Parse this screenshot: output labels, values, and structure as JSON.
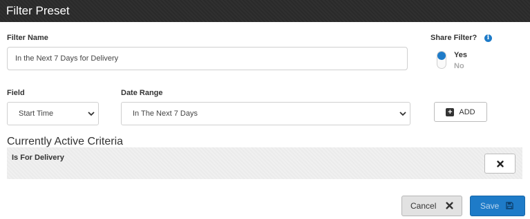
{
  "dialog": {
    "title": "Filter Preset"
  },
  "filter_name": {
    "label": "Filter Name",
    "value": "In the Next 7 Days for Delivery"
  },
  "share": {
    "label": "Share Filter?",
    "info_icon": "info-icon",
    "yes": "Yes",
    "no": "No",
    "selected": "Yes"
  },
  "field": {
    "label": "Field",
    "value": "Start Time"
  },
  "date_range": {
    "label": "Date Range",
    "value": "In The Next 7 Days"
  },
  "add_button": {
    "label": "ADD",
    "icon": "plus-square-icon"
  },
  "criteria": {
    "title": "Currently Active Criteria",
    "items": [
      {
        "label": "Is For Delivery"
      }
    ]
  },
  "footer": {
    "cancel_label": "Cancel",
    "save_label": "Save"
  },
  "colors": {
    "accent": "#1e7bc8",
    "titlebar": "#2e2e2e"
  }
}
